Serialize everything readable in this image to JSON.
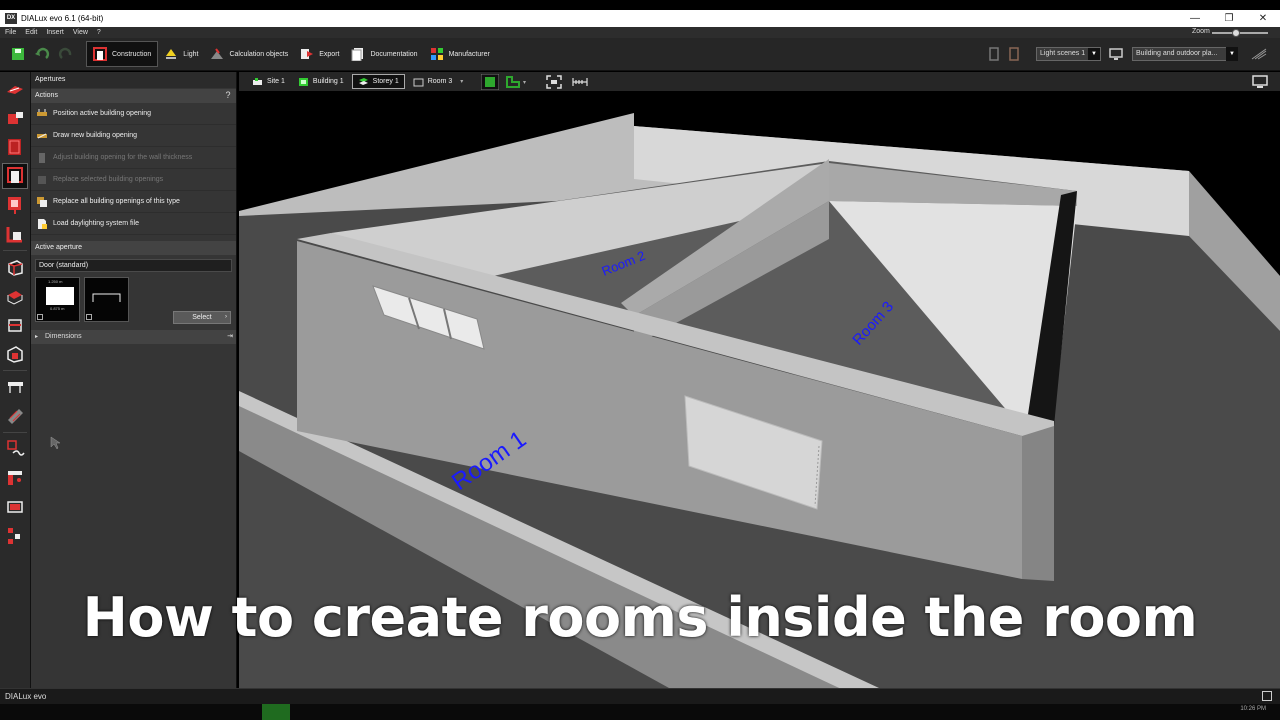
{
  "window": {
    "title": "DIALux evo 6.1  (64-bit)",
    "app_icon": "DX",
    "min_label": "—",
    "max_label": "❐",
    "close_label": "✕"
  },
  "menu": [
    "File",
    "Edit",
    "Insert",
    "View",
    "?"
  ],
  "toolbar": {
    "tabs": [
      {
        "label": "Construction",
        "icon": "construction-icon"
      },
      {
        "label": "Light",
        "icon": "lamp-icon"
      },
      {
        "label": "Calculation objects",
        "icon": "calculation-icon"
      },
      {
        "label": "Export",
        "icon": "export-icon"
      },
      {
        "label": "Documentation",
        "icon": "documentation-icon"
      },
      {
        "label": "Manufacturer",
        "icon": "manufacturer-icon"
      }
    ],
    "zoom_label": "Zoom",
    "light_scene": "Light scenes 1",
    "view_mode": "Building and outdoor pla..."
  },
  "panel": {
    "title": "Apertures",
    "actions_header": "Actions",
    "actions": [
      {
        "label": "Position active building opening",
        "enabled": true
      },
      {
        "label": "Draw new building opening",
        "enabled": true
      },
      {
        "label": "Adjust building opening for the wall thickness",
        "enabled": false
      },
      {
        "label": "Replace selected building openings",
        "enabled": false
      },
      {
        "label": "Replace all building openings of this type",
        "enabled": true
      },
      {
        "label": "Load daylighting system file",
        "enabled": true
      }
    ],
    "active_aperture_header": "Active aperture",
    "active_aperture_name": "Door (standard)",
    "dim_width": "1.250 m",
    "dim_height": "0.875 m",
    "select_label": "Select",
    "dimensions_header": "Dimensions"
  },
  "view_tabs": [
    {
      "label": "Site 1",
      "active": false
    },
    {
      "label": "Building 1",
      "active": false
    },
    {
      "label": "Storey 1",
      "active": true
    },
    {
      "label": "Room 3",
      "active": false
    }
  ],
  "rooms": [
    "Room 1",
    "Room 2",
    "Room 3"
  ],
  "caption": "How to create rooms inside the room",
  "status": "DIALux evo",
  "clock": "10:26 PM",
  "colors": {
    "accent_green": "#2ea82e",
    "room_label_blue": "#1a1aff",
    "wall_top": "#c8c8c8",
    "floor": "#555555"
  }
}
